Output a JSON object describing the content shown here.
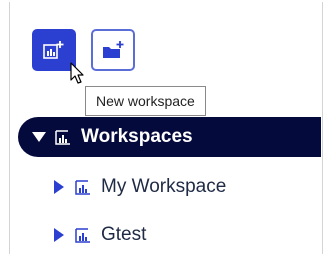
{
  "toolbar": {
    "new_workspace_button": {
      "icon": "workspace-add-icon",
      "color": "#2b3fd1"
    },
    "new_folder_button": {
      "icon": "folder-add-icon",
      "color": "#2b3fd1"
    }
  },
  "tooltip": {
    "text": "New workspace"
  },
  "tree": {
    "root": {
      "label": "Workspaces",
      "expanded": true,
      "icon": "workspace-icon",
      "background": "#050a3c"
    },
    "children": [
      {
        "label": "My Workspace",
        "expanded": false,
        "icon": "workspace-icon"
      },
      {
        "label": "Gtest",
        "expanded": false,
        "icon": "workspace-icon"
      }
    ]
  }
}
